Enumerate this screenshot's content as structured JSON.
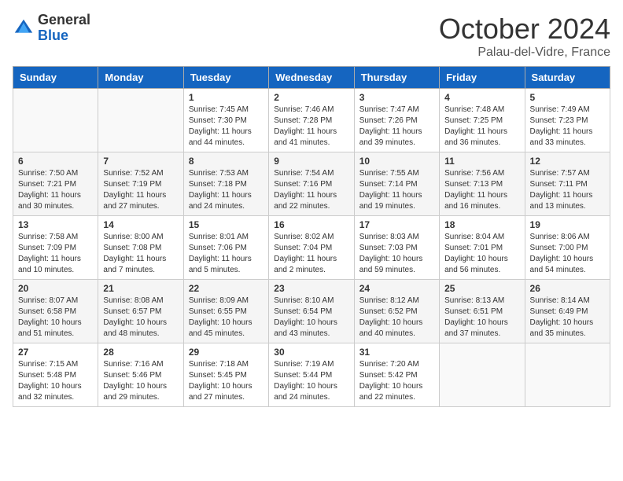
{
  "header": {
    "logo_general": "General",
    "logo_blue": "Blue",
    "title": "October 2024",
    "location": "Palau-del-Vidre, France"
  },
  "weekdays": [
    "Sunday",
    "Monday",
    "Tuesday",
    "Wednesday",
    "Thursday",
    "Friday",
    "Saturday"
  ],
  "weeks": [
    [
      {
        "day": "",
        "sunrise": "",
        "sunset": "",
        "daylight": ""
      },
      {
        "day": "",
        "sunrise": "",
        "sunset": "",
        "daylight": ""
      },
      {
        "day": "1",
        "sunrise": "Sunrise: 7:45 AM",
        "sunset": "Sunset: 7:30 PM",
        "daylight": "Daylight: 11 hours and 44 minutes."
      },
      {
        "day": "2",
        "sunrise": "Sunrise: 7:46 AM",
        "sunset": "Sunset: 7:28 PM",
        "daylight": "Daylight: 11 hours and 41 minutes."
      },
      {
        "day": "3",
        "sunrise": "Sunrise: 7:47 AM",
        "sunset": "Sunset: 7:26 PM",
        "daylight": "Daylight: 11 hours and 39 minutes."
      },
      {
        "day": "4",
        "sunrise": "Sunrise: 7:48 AM",
        "sunset": "Sunset: 7:25 PM",
        "daylight": "Daylight: 11 hours and 36 minutes."
      },
      {
        "day": "5",
        "sunrise": "Sunrise: 7:49 AM",
        "sunset": "Sunset: 7:23 PM",
        "daylight": "Daylight: 11 hours and 33 minutes."
      }
    ],
    [
      {
        "day": "6",
        "sunrise": "Sunrise: 7:50 AM",
        "sunset": "Sunset: 7:21 PM",
        "daylight": "Daylight: 11 hours and 30 minutes."
      },
      {
        "day": "7",
        "sunrise": "Sunrise: 7:52 AM",
        "sunset": "Sunset: 7:19 PM",
        "daylight": "Daylight: 11 hours and 27 minutes."
      },
      {
        "day": "8",
        "sunrise": "Sunrise: 7:53 AM",
        "sunset": "Sunset: 7:18 PM",
        "daylight": "Daylight: 11 hours and 24 minutes."
      },
      {
        "day": "9",
        "sunrise": "Sunrise: 7:54 AM",
        "sunset": "Sunset: 7:16 PM",
        "daylight": "Daylight: 11 hours and 22 minutes."
      },
      {
        "day": "10",
        "sunrise": "Sunrise: 7:55 AM",
        "sunset": "Sunset: 7:14 PM",
        "daylight": "Daylight: 11 hours and 19 minutes."
      },
      {
        "day": "11",
        "sunrise": "Sunrise: 7:56 AM",
        "sunset": "Sunset: 7:13 PM",
        "daylight": "Daylight: 11 hours and 16 minutes."
      },
      {
        "day": "12",
        "sunrise": "Sunrise: 7:57 AM",
        "sunset": "Sunset: 7:11 PM",
        "daylight": "Daylight: 11 hours and 13 minutes."
      }
    ],
    [
      {
        "day": "13",
        "sunrise": "Sunrise: 7:58 AM",
        "sunset": "Sunset: 7:09 PM",
        "daylight": "Daylight: 11 hours and 10 minutes."
      },
      {
        "day": "14",
        "sunrise": "Sunrise: 8:00 AM",
        "sunset": "Sunset: 7:08 PM",
        "daylight": "Daylight: 11 hours and 7 minutes."
      },
      {
        "day": "15",
        "sunrise": "Sunrise: 8:01 AM",
        "sunset": "Sunset: 7:06 PM",
        "daylight": "Daylight: 11 hours and 5 minutes."
      },
      {
        "day": "16",
        "sunrise": "Sunrise: 8:02 AM",
        "sunset": "Sunset: 7:04 PM",
        "daylight": "Daylight: 11 hours and 2 minutes."
      },
      {
        "day": "17",
        "sunrise": "Sunrise: 8:03 AM",
        "sunset": "Sunset: 7:03 PM",
        "daylight": "Daylight: 10 hours and 59 minutes."
      },
      {
        "day": "18",
        "sunrise": "Sunrise: 8:04 AM",
        "sunset": "Sunset: 7:01 PM",
        "daylight": "Daylight: 10 hours and 56 minutes."
      },
      {
        "day": "19",
        "sunrise": "Sunrise: 8:06 AM",
        "sunset": "Sunset: 7:00 PM",
        "daylight": "Daylight: 10 hours and 54 minutes."
      }
    ],
    [
      {
        "day": "20",
        "sunrise": "Sunrise: 8:07 AM",
        "sunset": "Sunset: 6:58 PM",
        "daylight": "Daylight: 10 hours and 51 minutes."
      },
      {
        "day": "21",
        "sunrise": "Sunrise: 8:08 AM",
        "sunset": "Sunset: 6:57 PM",
        "daylight": "Daylight: 10 hours and 48 minutes."
      },
      {
        "day": "22",
        "sunrise": "Sunrise: 8:09 AM",
        "sunset": "Sunset: 6:55 PM",
        "daylight": "Daylight: 10 hours and 45 minutes."
      },
      {
        "day": "23",
        "sunrise": "Sunrise: 8:10 AM",
        "sunset": "Sunset: 6:54 PM",
        "daylight": "Daylight: 10 hours and 43 minutes."
      },
      {
        "day": "24",
        "sunrise": "Sunrise: 8:12 AM",
        "sunset": "Sunset: 6:52 PM",
        "daylight": "Daylight: 10 hours and 40 minutes."
      },
      {
        "day": "25",
        "sunrise": "Sunrise: 8:13 AM",
        "sunset": "Sunset: 6:51 PM",
        "daylight": "Daylight: 10 hours and 37 minutes."
      },
      {
        "day": "26",
        "sunrise": "Sunrise: 8:14 AM",
        "sunset": "Sunset: 6:49 PM",
        "daylight": "Daylight: 10 hours and 35 minutes."
      }
    ],
    [
      {
        "day": "27",
        "sunrise": "Sunrise: 7:15 AM",
        "sunset": "Sunset: 5:48 PM",
        "daylight": "Daylight: 10 hours and 32 minutes."
      },
      {
        "day": "28",
        "sunrise": "Sunrise: 7:16 AM",
        "sunset": "Sunset: 5:46 PM",
        "daylight": "Daylight: 10 hours and 29 minutes."
      },
      {
        "day": "29",
        "sunrise": "Sunrise: 7:18 AM",
        "sunset": "Sunset: 5:45 PM",
        "daylight": "Daylight: 10 hours and 27 minutes."
      },
      {
        "day": "30",
        "sunrise": "Sunrise: 7:19 AM",
        "sunset": "Sunset: 5:44 PM",
        "daylight": "Daylight: 10 hours and 24 minutes."
      },
      {
        "day": "31",
        "sunrise": "Sunrise: 7:20 AM",
        "sunset": "Sunset: 5:42 PM",
        "daylight": "Daylight: 10 hours and 22 minutes."
      },
      {
        "day": "",
        "sunrise": "",
        "sunset": "",
        "daylight": ""
      },
      {
        "day": "",
        "sunrise": "",
        "sunset": "",
        "daylight": ""
      }
    ]
  ]
}
